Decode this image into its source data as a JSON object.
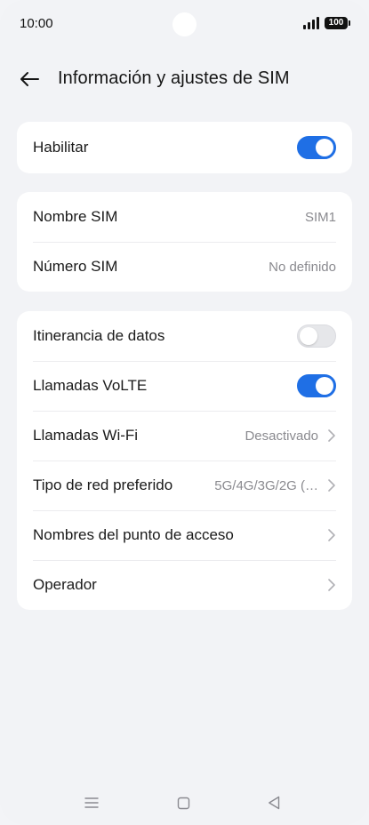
{
  "status_bar": {
    "time": "10:00",
    "battery": "100"
  },
  "header": {
    "title": "Información y ajustes de SIM"
  },
  "card1": {
    "habilitar": {
      "label": "Habilitar",
      "on": true
    }
  },
  "card2": {
    "rows": [
      {
        "label": "Nombre SIM",
        "value": "SIM1"
      },
      {
        "label": "Número SIM",
        "value": "No definido"
      }
    ]
  },
  "card3": {
    "roaming": {
      "label": "Itinerancia de datos",
      "on": false
    },
    "volte": {
      "label": "Llamadas VoLTE",
      "on": true
    },
    "wifi_calls": {
      "label": "Llamadas Wi-Fi",
      "value": "Desactivado"
    },
    "network": {
      "label": "Tipo de red preferido",
      "value": "5G/4G/3G/2G (…"
    },
    "apn": {
      "label": "Nombres del punto de acceso"
    },
    "operator": {
      "label": "Operador"
    }
  },
  "colors": {
    "accent": "#1f6fe5",
    "background": "#f2f3f6",
    "card": "#ffffff"
  }
}
